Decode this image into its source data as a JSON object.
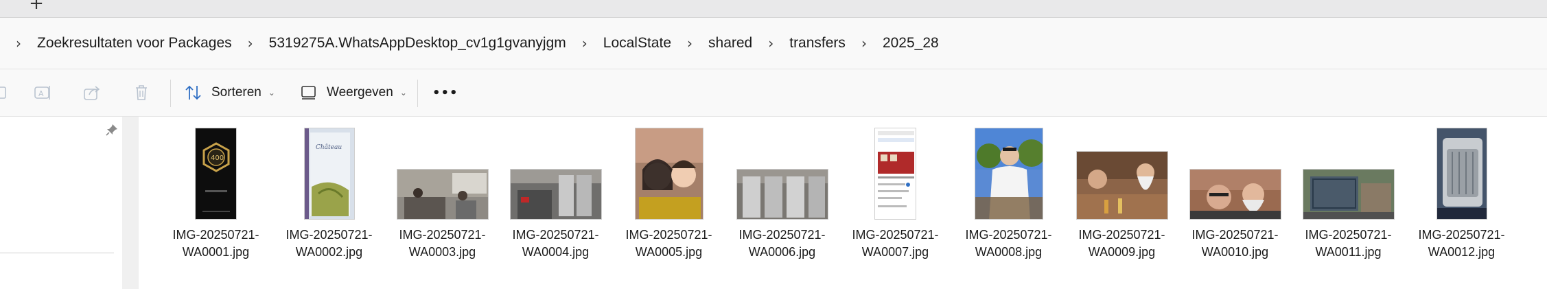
{
  "tabstrip": {
    "new_tab_label": "+"
  },
  "breadcrumb": [
    "Zoekresultaten voor Packages",
    "5319275A.WhatsAppDesktop_cv1g1gvanyjgm",
    "LocalState",
    "shared",
    "transfers",
    "2025_28"
  ],
  "commandbar": {
    "sort_label": "Sorteren",
    "view_label": "Weergeven",
    "more_label": "•••"
  },
  "files": [
    {
      "name": "IMG-20250721-WA0001.jpg",
      "line1": "IMG-20250721-",
      "line2": "WA0001.jpg",
      "icon": "phone-badge-screenshot"
    },
    {
      "name": "IMG-20250721-WA0002.jpg",
      "line1": "IMG-20250721-",
      "line2": "WA0002.jpg",
      "icon": "wine-label-photo"
    },
    {
      "name": "IMG-20250721-WA0003.jpg",
      "line1": "IMG-20250721-",
      "line2": "WA0003.jpg",
      "icon": "living-room-photo"
    },
    {
      "name": "IMG-20250721-WA0004.jpg",
      "line1": "IMG-20250721-",
      "line2": "WA0004.jpg",
      "icon": "cellar-photo"
    },
    {
      "name": "IMG-20250721-WA0005.jpg",
      "line1": "IMG-20250721-",
      "line2": "WA0005.jpg",
      "icon": "selfie-photo"
    },
    {
      "name": "IMG-20250721-WA0006.jpg",
      "line1": "IMG-20250721-",
      "line2": "WA0006.jpg",
      "icon": "tanks-photo"
    },
    {
      "name": "IMG-20250721-WA0007.jpg",
      "line1": "IMG-20250721-",
      "line2": "WA0007.jpg",
      "icon": "maps-screenshot"
    },
    {
      "name": "IMG-20250721-WA0008.jpg",
      "line1": "IMG-20250721-",
      "line2": "WA0008.jpg",
      "icon": "vineyard-portrait-photo"
    },
    {
      "name": "IMG-20250721-WA0009.jpg",
      "line1": "IMG-20250721-",
      "line2": "WA0009.jpg",
      "icon": "dinner-photo"
    },
    {
      "name": "IMG-20250721-WA0010.jpg",
      "line1": "IMG-20250721-",
      "line2": "WA0010.jpg",
      "icon": "selfie-men-photo"
    },
    {
      "name": "IMG-20250721-WA0011.jpg",
      "line1": "IMG-20250721-",
      "line2": "WA0011.jpg",
      "icon": "cage-photo"
    },
    {
      "name": "IMG-20250721-WA0012.jpg",
      "line1": "IMG-20250721-",
      "line2": "WA0012.jpg",
      "icon": "pet-carrier-photo"
    }
  ]
}
